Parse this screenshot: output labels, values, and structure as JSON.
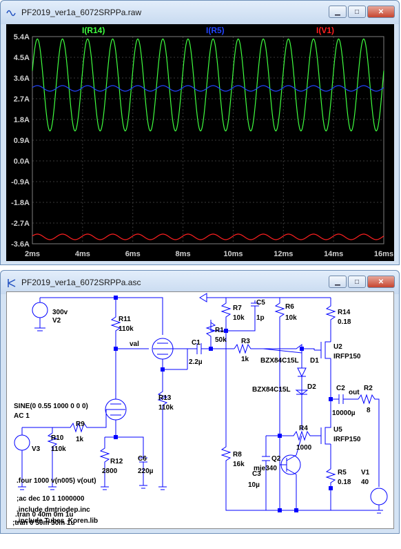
{
  "waveform_window": {
    "title": "PF2019_ver1a_6072SRPPa.raw",
    "controls": {
      "minimize": "▁",
      "maximize": "□",
      "close": "✕"
    },
    "colors": {
      "background": "#000000",
      "trace_r14": "#40ff40",
      "trace_r5": "#2244ff",
      "trace_v1": "#ff2020",
      "axis_text": "#d0d0d0"
    },
    "chart_data": {
      "type": "line",
      "title": "",
      "xlabel": "",
      "ylabel": "",
      "x_ticks": [
        "2ms",
        "4ms",
        "6ms",
        "8ms",
        "10ms",
        "12ms",
        "14ms",
        "16ms"
      ],
      "y_ticks": [
        "5.4A",
        "4.5A",
        "3.6A",
        "2.7A",
        "1.8A",
        "0.9A",
        "0.0A",
        "-0.9A",
        "-1.8A",
        "-2.7A",
        "-3.6A"
      ],
      "xlim": [
        2,
        16
      ],
      "ylim": [
        -3.6,
        5.4
      ],
      "grid": true,
      "legend": "top",
      "series": [
        {
          "name": "I(R14)",
          "color": "#40ff40",
          "offset": 3.3,
          "amplitude": 2.0,
          "frequency_khz": 1.0
        },
        {
          "name": "I(R5)",
          "color": "#2244ff",
          "offset": 3.15,
          "amplitude": 0.12,
          "frequency_khz": 1.0
        },
        {
          "name": "I(V1)",
          "color": "#ff2020",
          "offset": -3.3,
          "amplitude": 0.12,
          "frequency_khz": 1.0
        }
      ]
    }
  },
  "schematic_window": {
    "title": "PF2019_ver1a_6072SRPPa.asc",
    "controls": {
      "minimize": "▁",
      "maximize": "□",
      "close": "✕"
    },
    "labels": {
      "v2_val": "300v",
      "v2": "V2",
      "r11": "R11",
      "r11_val": "110k",
      "val_net": "val",
      "c1": "C1",
      "c1_val": "2.2µ",
      "r1": "R1",
      "r1_val": "50k",
      "r7": "R7",
      "r7_val": "10k",
      "c5": "C5",
      "c5_val": "1p",
      "r6": "R6",
      "r6_val": "10k",
      "r14": "R14",
      "r14_val": "0.18",
      "u2": "U2",
      "u2_val": "IRFP150",
      "r3": "R3",
      "r3_val": "1k",
      "d1_val": "BZX84C15L",
      "d1": "D1",
      "d2_val": "BZX84C15L",
      "d2": "D2",
      "c2": "C2",
      "c2_val": "10000µ",
      "out_net": "out",
      "r2": "R2",
      "r2_val": "8",
      "u5": "U5",
      "u5_val": "IRFP150",
      "r4": "R4",
      "r4_val": "1000",
      "q2": "Q2",
      "q2_val": "mje340",
      "c3": "C3",
      "c3_val": "10µ",
      "r5": "R5",
      "r5_val": "0.18",
      "v1": "V1",
      "v1_val": "40",
      "r8": "R8",
      "r8_val": "16k",
      "r13": "R13",
      "r13_val": "110k",
      "r12": "R12",
      "r12_val": "2800",
      "c6": "C6",
      "c6_val": "220µ",
      "r9": "R9",
      "r9_val": "1k",
      "r10": "R10",
      "r10_val": "110k",
      "v3": "V3",
      "sine": "SINE(0 0.55 1000 0 0 0)",
      "ac": "AC 1"
    },
    "directives": [
      ".four 1000 v(n005) v(out)",
      ";ac dec 10 1 1000000",
      ".include dmtriodep.inc",
      ".include Tubes_Koren.lib",
      ".tran 0 40m 0m 1u",
      ";tran 0 50m 30m 1u"
    ]
  }
}
